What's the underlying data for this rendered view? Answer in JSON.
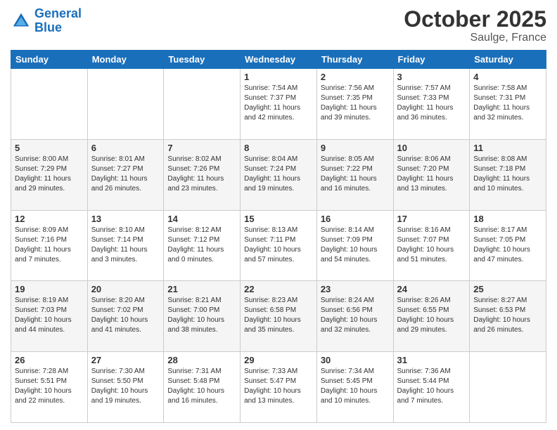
{
  "header": {
    "logo_line1": "General",
    "logo_line2": "Blue",
    "month": "October 2025",
    "location": "Saulge, France"
  },
  "days_of_week": [
    "Sunday",
    "Monday",
    "Tuesday",
    "Wednesday",
    "Thursday",
    "Friday",
    "Saturday"
  ],
  "weeks": [
    [
      {
        "day": "",
        "info": ""
      },
      {
        "day": "",
        "info": ""
      },
      {
        "day": "",
        "info": ""
      },
      {
        "day": "1",
        "info": "Sunrise: 7:54 AM\nSunset: 7:37 PM\nDaylight: 11 hours\nand 42 minutes."
      },
      {
        "day": "2",
        "info": "Sunrise: 7:56 AM\nSunset: 7:35 PM\nDaylight: 11 hours\nand 39 minutes."
      },
      {
        "day": "3",
        "info": "Sunrise: 7:57 AM\nSunset: 7:33 PM\nDaylight: 11 hours\nand 36 minutes."
      },
      {
        "day": "4",
        "info": "Sunrise: 7:58 AM\nSunset: 7:31 PM\nDaylight: 11 hours\nand 32 minutes."
      }
    ],
    [
      {
        "day": "5",
        "info": "Sunrise: 8:00 AM\nSunset: 7:29 PM\nDaylight: 11 hours\nand 29 minutes."
      },
      {
        "day": "6",
        "info": "Sunrise: 8:01 AM\nSunset: 7:27 PM\nDaylight: 11 hours\nand 26 minutes."
      },
      {
        "day": "7",
        "info": "Sunrise: 8:02 AM\nSunset: 7:26 PM\nDaylight: 11 hours\nand 23 minutes."
      },
      {
        "day": "8",
        "info": "Sunrise: 8:04 AM\nSunset: 7:24 PM\nDaylight: 11 hours\nand 19 minutes."
      },
      {
        "day": "9",
        "info": "Sunrise: 8:05 AM\nSunset: 7:22 PM\nDaylight: 11 hours\nand 16 minutes."
      },
      {
        "day": "10",
        "info": "Sunrise: 8:06 AM\nSunset: 7:20 PM\nDaylight: 11 hours\nand 13 minutes."
      },
      {
        "day": "11",
        "info": "Sunrise: 8:08 AM\nSunset: 7:18 PM\nDaylight: 11 hours\nand 10 minutes."
      }
    ],
    [
      {
        "day": "12",
        "info": "Sunrise: 8:09 AM\nSunset: 7:16 PM\nDaylight: 11 hours\nand 7 minutes."
      },
      {
        "day": "13",
        "info": "Sunrise: 8:10 AM\nSunset: 7:14 PM\nDaylight: 11 hours\nand 3 minutes."
      },
      {
        "day": "14",
        "info": "Sunrise: 8:12 AM\nSunset: 7:12 PM\nDaylight: 11 hours\nand 0 minutes."
      },
      {
        "day": "15",
        "info": "Sunrise: 8:13 AM\nSunset: 7:11 PM\nDaylight: 10 hours\nand 57 minutes."
      },
      {
        "day": "16",
        "info": "Sunrise: 8:14 AM\nSunset: 7:09 PM\nDaylight: 10 hours\nand 54 minutes."
      },
      {
        "day": "17",
        "info": "Sunrise: 8:16 AM\nSunset: 7:07 PM\nDaylight: 10 hours\nand 51 minutes."
      },
      {
        "day": "18",
        "info": "Sunrise: 8:17 AM\nSunset: 7:05 PM\nDaylight: 10 hours\nand 47 minutes."
      }
    ],
    [
      {
        "day": "19",
        "info": "Sunrise: 8:19 AM\nSunset: 7:03 PM\nDaylight: 10 hours\nand 44 minutes."
      },
      {
        "day": "20",
        "info": "Sunrise: 8:20 AM\nSunset: 7:02 PM\nDaylight: 10 hours\nand 41 minutes."
      },
      {
        "day": "21",
        "info": "Sunrise: 8:21 AM\nSunset: 7:00 PM\nDaylight: 10 hours\nand 38 minutes."
      },
      {
        "day": "22",
        "info": "Sunrise: 8:23 AM\nSunset: 6:58 PM\nDaylight: 10 hours\nand 35 minutes."
      },
      {
        "day": "23",
        "info": "Sunrise: 8:24 AM\nSunset: 6:56 PM\nDaylight: 10 hours\nand 32 minutes."
      },
      {
        "day": "24",
        "info": "Sunrise: 8:26 AM\nSunset: 6:55 PM\nDaylight: 10 hours\nand 29 minutes."
      },
      {
        "day": "25",
        "info": "Sunrise: 8:27 AM\nSunset: 6:53 PM\nDaylight: 10 hours\nand 26 minutes."
      }
    ],
    [
      {
        "day": "26",
        "info": "Sunrise: 7:28 AM\nSunset: 5:51 PM\nDaylight: 10 hours\nand 22 minutes."
      },
      {
        "day": "27",
        "info": "Sunrise: 7:30 AM\nSunset: 5:50 PM\nDaylight: 10 hours\nand 19 minutes."
      },
      {
        "day": "28",
        "info": "Sunrise: 7:31 AM\nSunset: 5:48 PM\nDaylight: 10 hours\nand 16 minutes."
      },
      {
        "day": "29",
        "info": "Sunrise: 7:33 AM\nSunset: 5:47 PM\nDaylight: 10 hours\nand 13 minutes."
      },
      {
        "day": "30",
        "info": "Sunrise: 7:34 AM\nSunset: 5:45 PM\nDaylight: 10 hours\nand 10 minutes."
      },
      {
        "day": "31",
        "info": "Sunrise: 7:36 AM\nSunset: 5:44 PM\nDaylight: 10 hours\nand 7 minutes."
      },
      {
        "day": "",
        "info": ""
      }
    ]
  ]
}
